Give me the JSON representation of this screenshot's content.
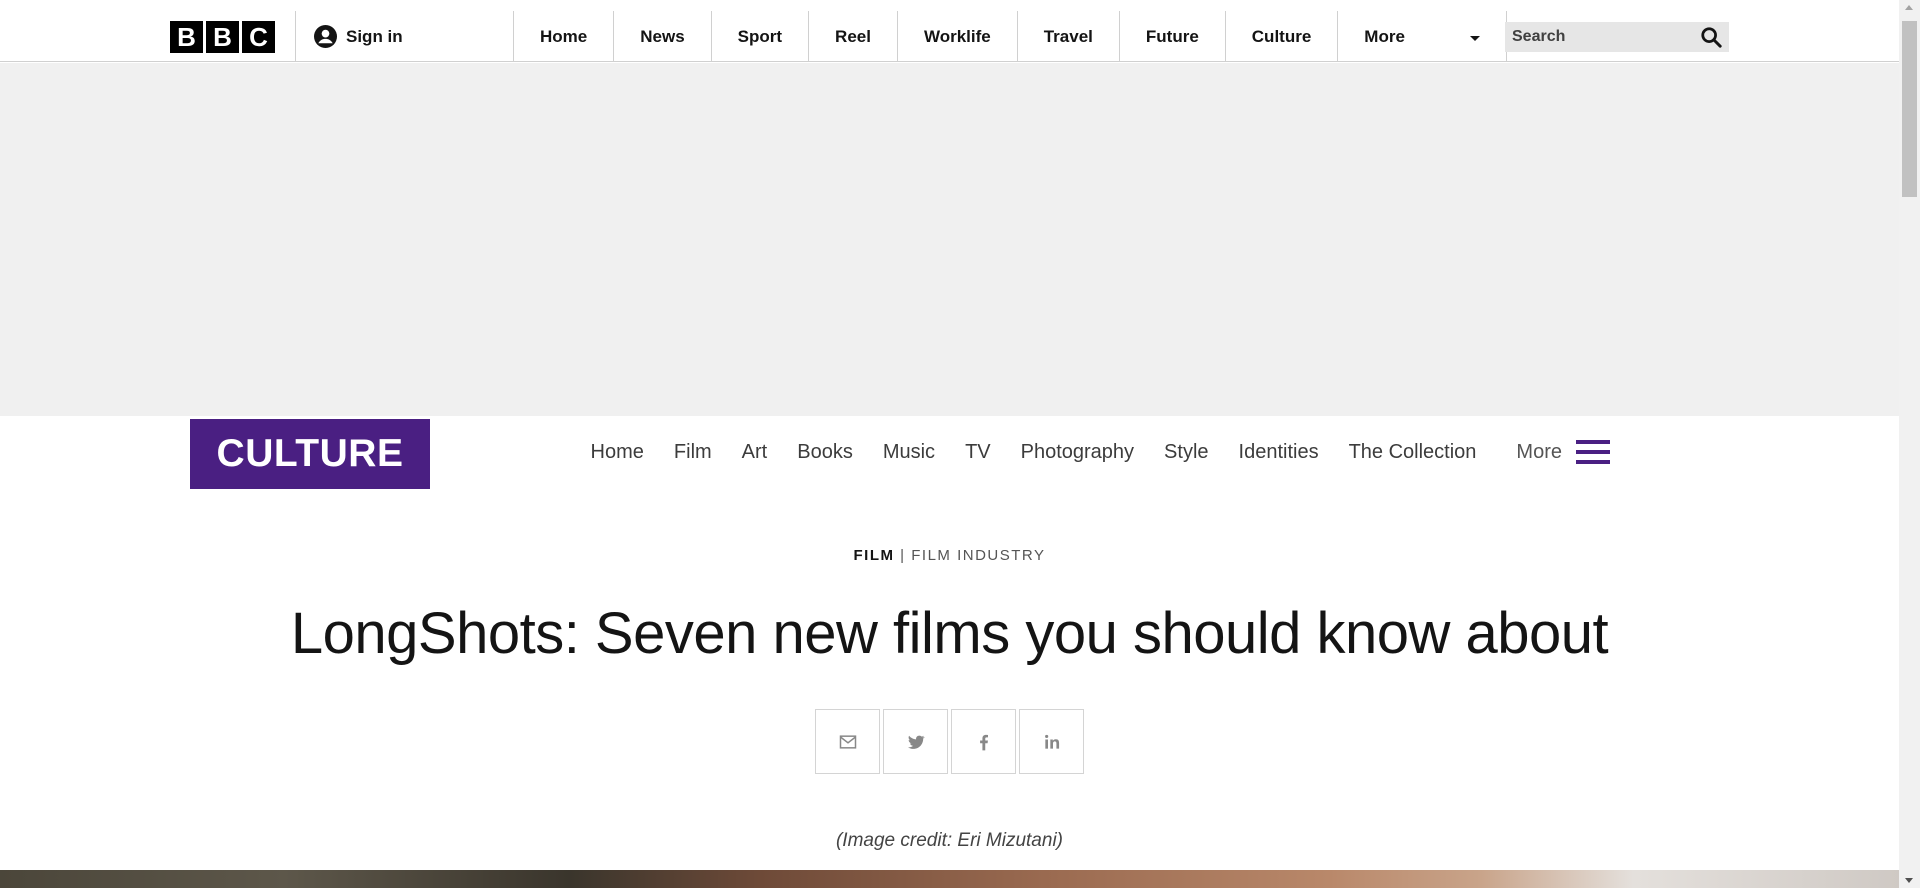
{
  "topbar": {
    "logo_letters": [
      "B",
      "B",
      "C"
    ],
    "sign_in_label": "Sign in",
    "nav_items": [
      "Home",
      "News",
      "Sport",
      "Reel",
      "Worklife",
      "Travel",
      "Future",
      "Culture"
    ],
    "more_label": "More",
    "search_placeholder": "Search"
  },
  "culture": {
    "logo_text": "CULTURE",
    "nav_items": [
      "Home",
      "Film",
      "Art",
      "Books",
      "Music",
      "TV",
      "Photography",
      "Style",
      "Identities",
      "The Collection"
    ],
    "more_label": "More",
    "brand_color": "#4a1f82"
  },
  "article": {
    "section": "FILM",
    "separator": "|",
    "subsection": "FILM INDUSTRY",
    "title": "LongShots: Seven new films you should know about",
    "share_icons": [
      "email-icon",
      "twitter-icon",
      "facebook-icon",
      "linkedin-icon"
    ],
    "image_credit": "(Image credit: Eri Mizutani)"
  }
}
